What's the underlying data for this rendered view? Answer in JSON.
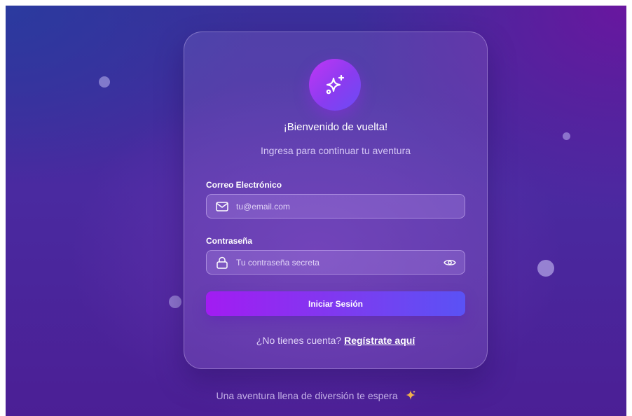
{
  "login": {
    "title": "¡Bienvenido de vuelta!",
    "subtitle": "Ingresa para continuar tu aventura",
    "email_label": "Correo Electrónico",
    "email_placeholder": "tu@email.com",
    "password_label": "Contraseña",
    "password_placeholder": "Tu contraseña secreta",
    "submit_label": "Iniciar Sesión",
    "signup_prompt": "¿No tienes cuenta? ",
    "signup_link": "Regístrate aquí"
  },
  "footer": {
    "text": "Una aventura llena de diversión te espera"
  },
  "icons": {
    "logo": "sparkles-icon",
    "email": "mail-icon",
    "password": "lock-icon",
    "toggle_password": "eye-icon",
    "footer": "sparkle-icon"
  },
  "colors": {
    "button_start": "#a21cf2",
    "button_end": "#5a52f5",
    "logo_start": "#c036f5",
    "logo_end": "#6a4cf6",
    "footer_sparkle": "#f2b24a"
  }
}
